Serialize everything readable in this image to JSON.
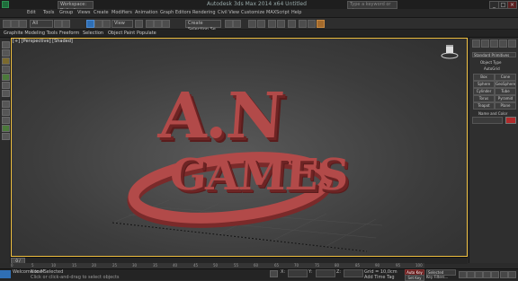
{
  "titlebar": {
    "workspace": "Workspace: Default",
    "title": "Autodesk 3ds Max 2014 x64  Untitled",
    "search_placeholder": "Type a keyword or phrase",
    "window_buttons": [
      "_",
      "□",
      "×"
    ]
  },
  "menu": [
    "Edit",
    "Tools",
    "Group",
    "Views",
    "Create",
    "Modifiers",
    "Animation",
    "Graph Editors",
    "Rendering",
    "Civil View",
    "Customize",
    "MAXScript",
    "Help"
  ],
  "toolbar": {
    "filter_select": "All",
    "coord_select": "View",
    "selection_set": "Create Selection Se"
  },
  "ribbon": {
    "tabs": [
      "Graphite Modeling Tools",
      "Freeform",
      "Selection",
      "Object Paint",
      "Populate"
    ]
  },
  "viewport": {
    "label": "[+] [Perspective] [Shaded]",
    "model_text": [
      "A.N",
      "GAMES"
    ],
    "model_color": "#b24a49",
    "border_color": "#f0c040"
  },
  "command_panel": {
    "category": "Standard Primitives",
    "object_type_label": "Object Type",
    "autogrid_label": "AutoGrid",
    "buttons": [
      "Box",
      "Cone",
      "Sphere",
      "GeoSphere",
      "Cylinder",
      "Tube",
      "Torus",
      "Pyramid",
      "Teapot",
      "Plane"
    ],
    "name_color_label": "Name and Color"
  },
  "timeline": {
    "position": "0 / 100",
    "ticks": [
      "0",
      "5",
      "10",
      "15",
      "20",
      "25",
      "30",
      "35",
      "40",
      "45",
      "50",
      "55",
      "60",
      "65",
      "70",
      "75",
      "80",
      "85",
      "90",
      "95",
      "100"
    ]
  },
  "status": {
    "selection_info": "None Selected",
    "prompt": "Click or click-and-drag to select objects",
    "welcome": "Welcome to M",
    "grid": "Grid = 10,0cm",
    "auto_key": "Auto Key",
    "set_key": "Set Key",
    "key_filter": "Selected",
    "key_filters_btn": "Key Filters...",
    "add_time_tag": "Add Time Tag",
    "x_label": "X:",
    "y_label": "Y:",
    "z_label": "Z:"
  }
}
